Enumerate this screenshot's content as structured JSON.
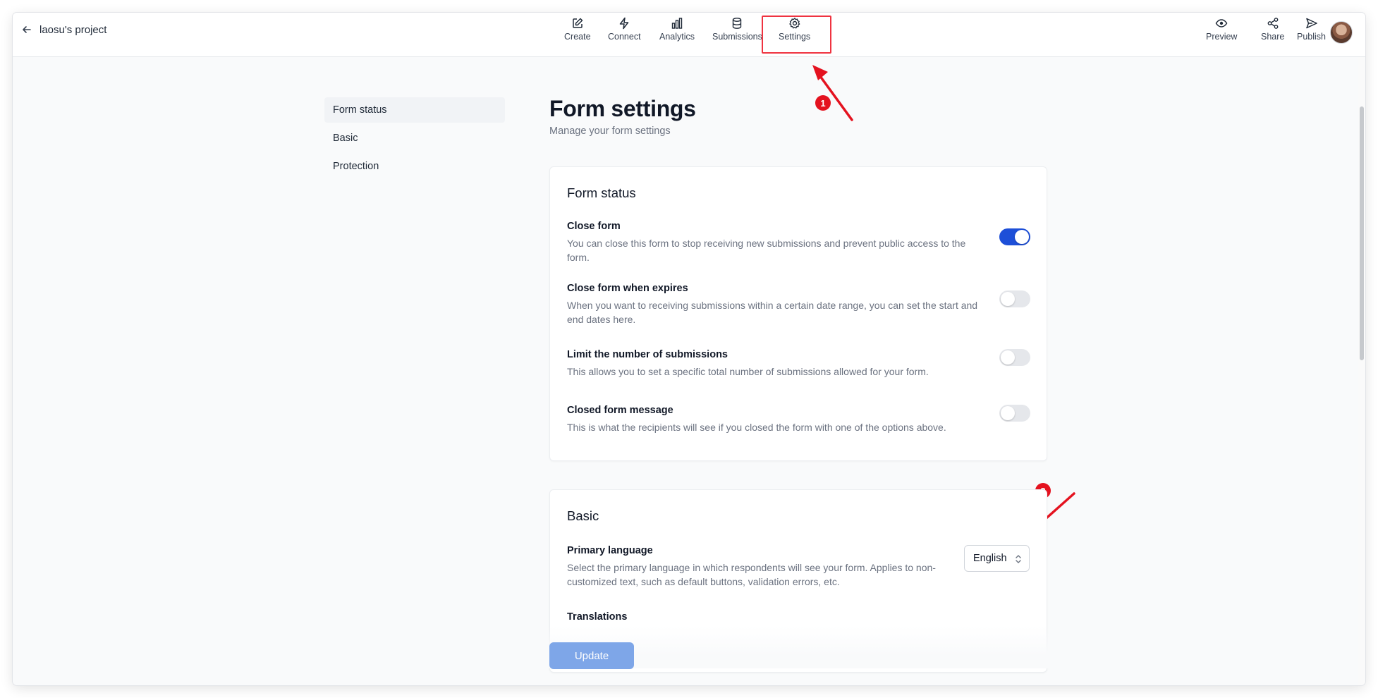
{
  "header": {
    "back_label": "laosu's project",
    "nav": [
      {
        "label": "Create",
        "icon": "pencil-square-icon"
      },
      {
        "label": "Connect",
        "icon": "bolt-icon"
      },
      {
        "label": "Analytics",
        "icon": "bar-chart-icon"
      },
      {
        "label": "Submissions",
        "icon": "database-icon"
      },
      {
        "label": "Settings",
        "icon": "gear-icon"
      }
    ],
    "actions": [
      {
        "label": "Preview",
        "icon": "eye-icon"
      },
      {
        "label": "Share",
        "icon": "share-icon"
      },
      {
        "label": "Publish",
        "icon": "send-icon"
      }
    ]
  },
  "annotations": {
    "step1": "1",
    "step2": "2",
    "color": "#e4121f"
  },
  "sidebar": {
    "items": [
      {
        "label": "Form status",
        "active": true
      },
      {
        "label": "Basic"
      },
      {
        "label": "Protection"
      }
    ]
  },
  "main": {
    "title": "Form settings",
    "subtitle": "Manage your form settings",
    "form_status": {
      "title": "Form status",
      "rows": [
        {
          "title": "Close form",
          "desc": "You can close this form to stop receiving new submissions and prevent public access to the form.",
          "enabled": true
        },
        {
          "title": "Close form when expires",
          "desc": "When you want to receiving submissions within a certain date range, you can set the start and end dates here.",
          "enabled": false
        },
        {
          "title": "Limit the number of submissions",
          "desc": "This allows you to set a specific total number of submissions allowed for your form.",
          "enabled": false
        },
        {
          "title": "Closed form message",
          "desc": "This is what the recipients will see if you closed the form with one of the options above.",
          "enabled": false
        }
      ]
    },
    "basic": {
      "title": "Basic",
      "primary_language": {
        "title": "Primary language",
        "desc": "Select the primary language in which respondents will see your form. Applies to non-customized text, such as default buttons, validation errors, etc.",
        "value": "English"
      },
      "translations": {
        "title": "Translations"
      }
    },
    "update_label": "Update",
    "accent": "#1d4fd8"
  }
}
